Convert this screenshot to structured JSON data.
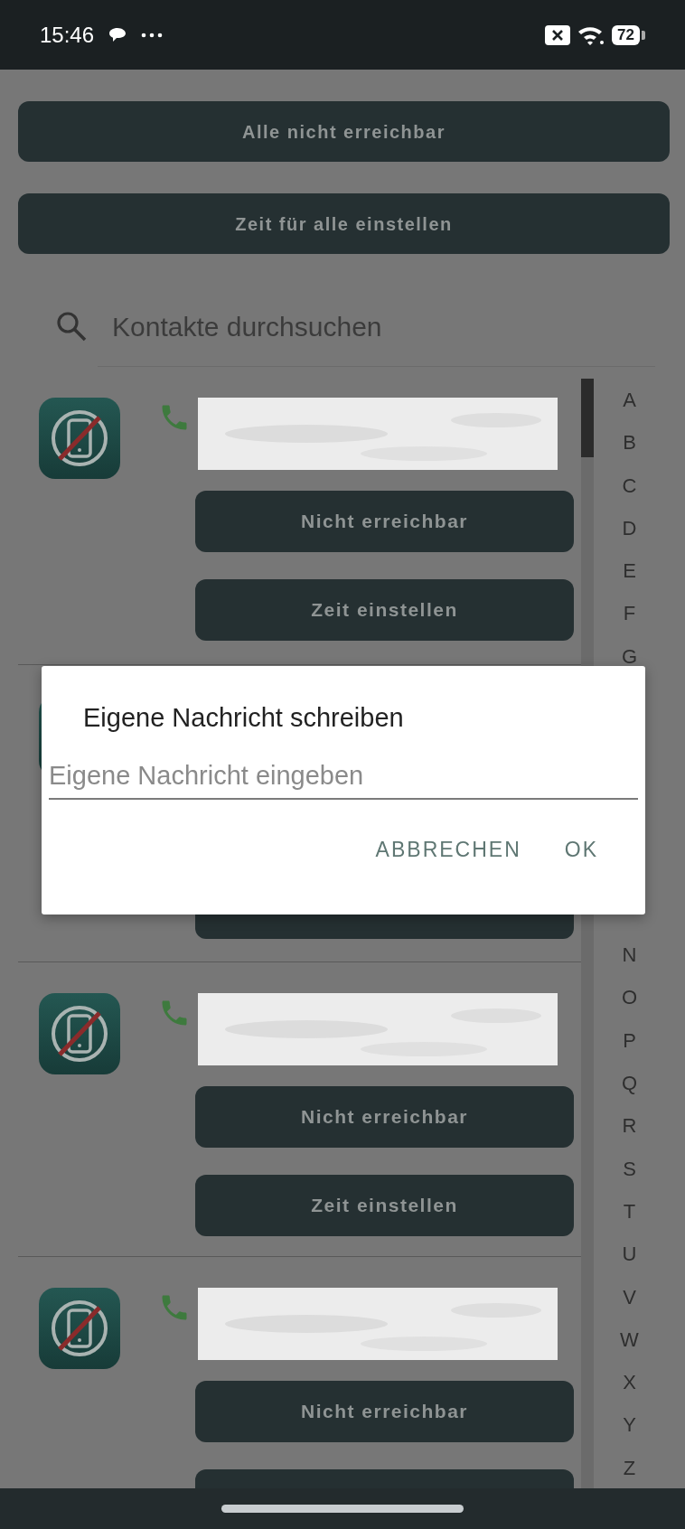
{
  "status_bar": {
    "time": "15:46",
    "battery": "72"
  },
  "top_buttons": [
    {
      "label": "Alle nicht erreichbar"
    },
    {
      "label": "Zeit für alle einstellen"
    }
  ],
  "search": {
    "placeholder": "Kontakte durchsuchen"
  },
  "contacts": [
    {
      "buttons": [
        {
          "kind": "button",
          "label": "Nicht erreichbar"
        },
        {
          "kind": "button",
          "label": "Zeit einstellen"
        }
      ]
    },
    {
      "buttons": [
        {
          "kind": "covered"
        },
        {
          "kind": "button"
        }
      ]
    },
    {
      "buttons": [
        {
          "kind": "button",
          "label": "Nicht erreichbar"
        },
        {
          "kind": "button",
          "label": "Zeit einstellen"
        }
      ]
    },
    {
      "buttons": [
        {
          "kind": "button",
          "label": "Nicht erreichbar"
        },
        {
          "kind": "button"
        }
      ]
    }
  ],
  "index_letters_top": [
    "A",
    "B",
    "C",
    "D",
    "E",
    "F",
    "G"
  ],
  "index_letters_bottom": [
    {
      "letter": "N"
    },
    {
      "letter": "O"
    },
    {
      "letter": "P"
    },
    {
      "letter": "Q"
    },
    {
      "letter": "R"
    },
    {
      "letter": "S"
    },
    {
      "letter": "T"
    },
    {
      "letter": "U"
    },
    {
      "letter": "V"
    },
    {
      "letter": "W"
    },
    {
      "letter": "X"
    },
    {
      "letter": "Y"
    },
    {
      "letter": "Z"
    }
  ],
  "dialog": {
    "title": "Eigene Nachricht schreiben",
    "input": {
      "placeholder": "Eigene Nachricht eingeben"
    },
    "buttons": [
      {
        "label": "ABBRECHEN"
      },
      {
        "label": "OK"
      }
    ]
  }
}
